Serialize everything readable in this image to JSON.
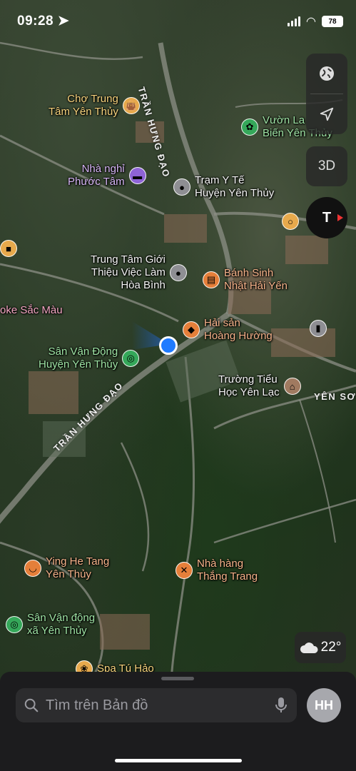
{
  "status_bar": {
    "time": "09:28",
    "battery": "78"
  },
  "map": {
    "streets": [
      "TRẦN HƯNG ĐẠO",
      "TRẦN HƯNG ĐẠO"
    ],
    "area_label": "YÊN SƠN",
    "pois": [
      {
        "l1": "Chợ Trung",
        "l2": "Tâm Yên Thủy",
        "icon": "shopping-bag-icon",
        "color": "#e7a94c"
      },
      {
        "l1": "Vườn La",
        "l2": "Biến Yên Thủy",
        "icon": "flower-icon",
        "color": "#35a85a"
      },
      {
        "l1": "Nhà nghỉ",
        "l2": "Phước Tâm",
        "icon": "bed-icon",
        "color": "#8e63d6"
      },
      {
        "l1": "Trạm Y Tế",
        "l2": "Huyện Yên Thủy",
        "icon": "location-dot-icon",
        "color": "#8e8e93"
      },
      {
        "l1": "",
        "l2": "",
        "icon": "ring-icon",
        "color": "#e7a94c"
      },
      {
        "l1": "Trung Tâm Giới",
        "l2": "Thiệu Việc Làm",
        "l3": "Hòa Bình",
        "icon": "location-dot-icon",
        "color": "#8e8e93"
      },
      {
        "l1": "Bánh Sinh",
        "l2": "Nhật Hải Yến",
        "icon": "cake-icon",
        "color": "#e57f3a"
      },
      {
        "l1": "oke Sắc Màu",
        "icon": "none",
        "color": "#e46aa1"
      },
      {
        "l1": "Hải sản",
        "l2": "Hoàng Hường",
        "icon": "fish-icon",
        "color": "#e57f3a"
      },
      {
        "l1": "Sân Vận Động",
        "l2": "Huyện Yên Thủy",
        "icon": "stadium-icon",
        "color": "#35a85a"
      },
      {
        "l1": "Trường Tiểu",
        "l2": "Học Yên Lạc",
        "icon": "school-icon",
        "color": "#a07a60"
      },
      {
        "l1": "Ying He Tang",
        "l2": "Yên Thủy",
        "icon": "bowl-icon",
        "color": "#e57f3a"
      },
      {
        "l1": "Nhà hàng",
        "l2": "Thắng Trang",
        "icon": "fork-knife-icon",
        "color": "#e57f3a"
      },
      {
        "l1": "Sân Vận động",
        "l2": "xã Yên Thủy",
        "icon": "stadium-icon",
        "color": "#35a85a"
      },
      {
        "l1": "Spa Tú Hảo",
        "icon": "lotus-icon",
        "color": "#e7a94c"
      },
      {
        "l1": "",
        "icon": "briefcase-icon",
        "color": "#e7a94c"
      },
      {
        "l1": "",
        "icon": "gas-icon",
        "color": "#8e8e93"
      }
    ]
  },
  "controls": {
    "map_mode": "globe-icon",
    "locate": "location-arrow-icon",
    "three_d": "3D",
    "compass": "T"
  },
  "weather": {
    "temp": "22°",
    "icon": "cloud-icon"
  },
  "search": {
    "placeholder": "Tìm trên Bản đồ",
    "avatar_initials": "HH"
  }
}
